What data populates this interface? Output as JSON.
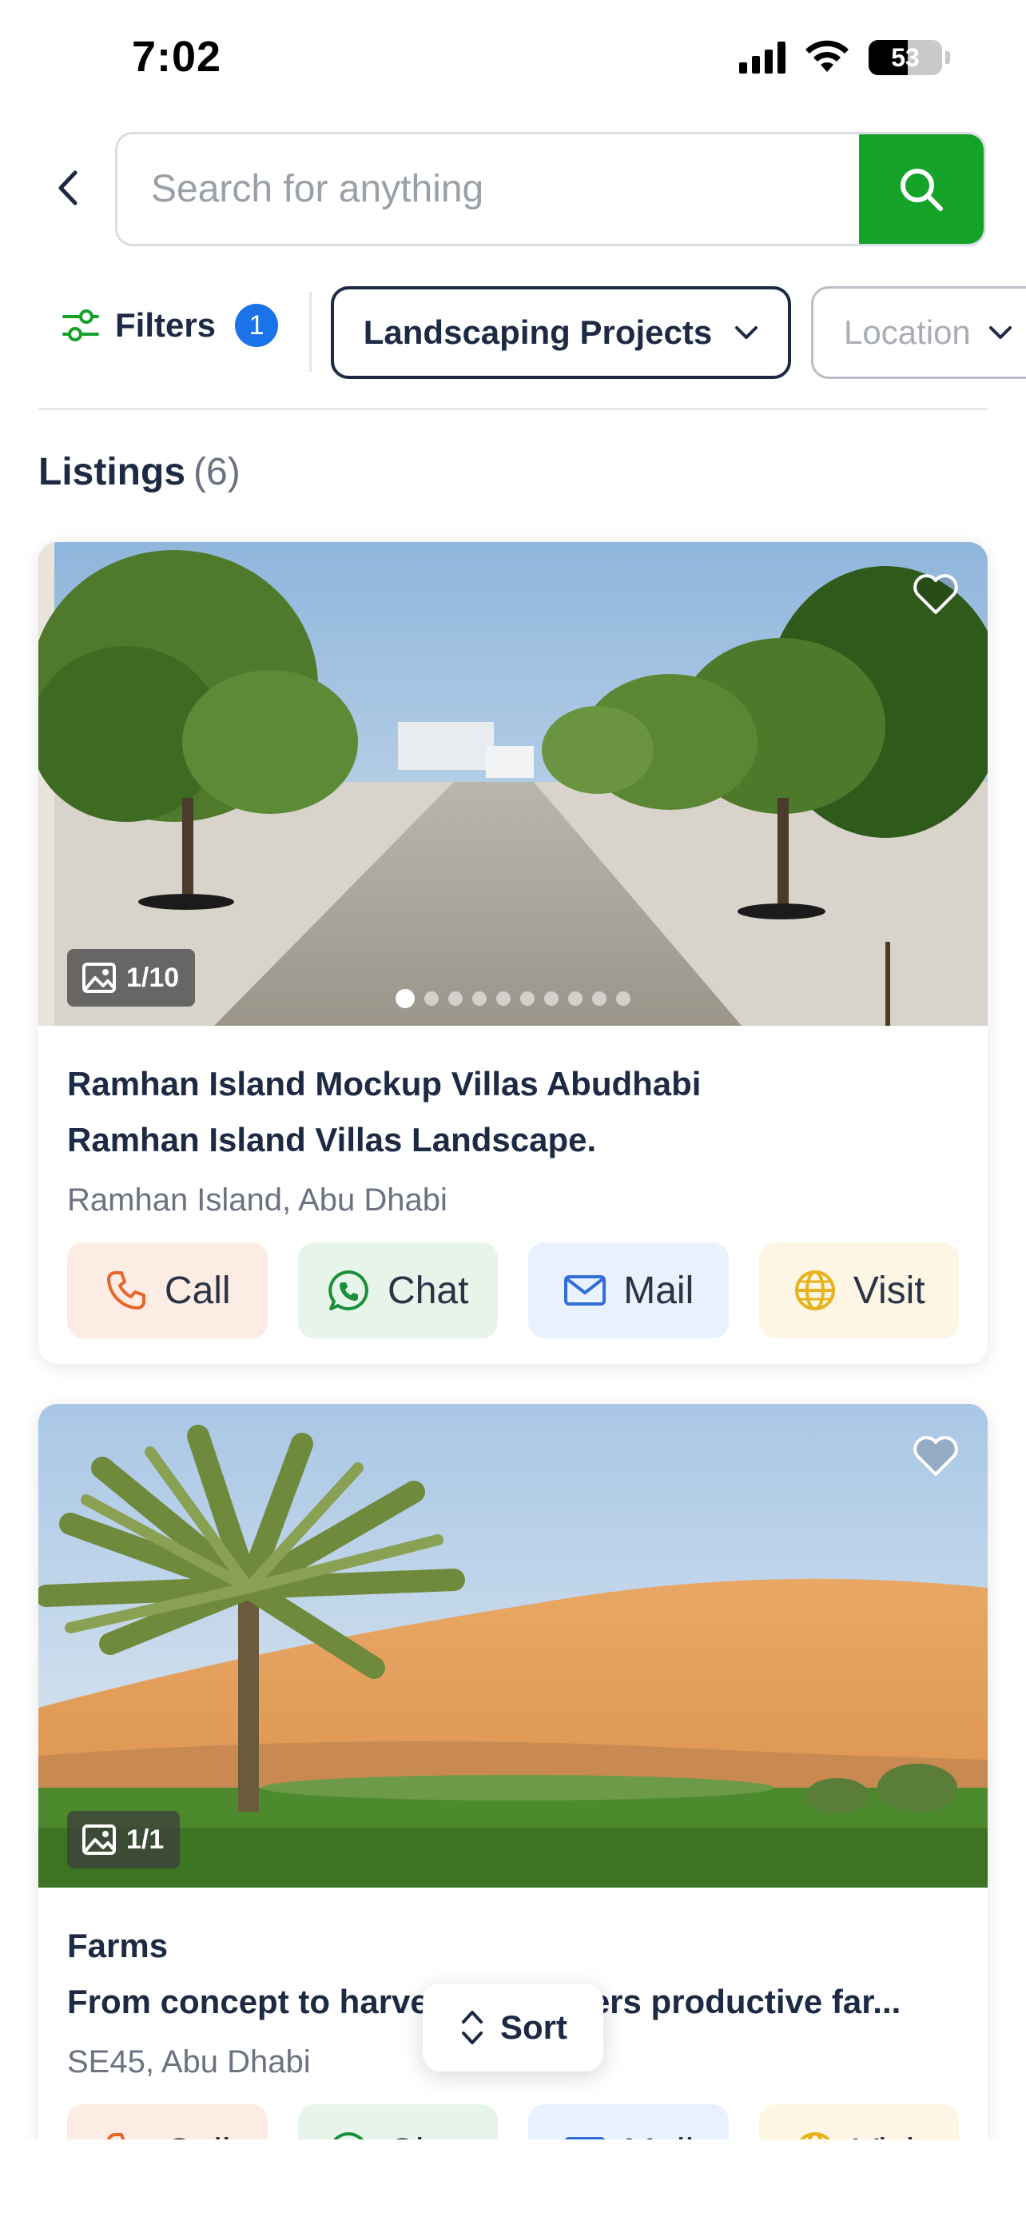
{
  "status_bar": {
    "time": "7:02",
    "battery": "53",
    "battery_level": 0.53
  },
  "search": {
    "placeholder": "Search for anything",
    "value": ""
  },
  "filters": {
    "label": "Filters",
    "badge_count": "1",
    "category_chip": "Landscaping Projects",
    "location_chip": "Location"
  },
  "listings": {
    "heading": "Listings",
    "count": "(6)",
    "items": [
      {
        "image_counter": "1/10",
        "title": "Ramhan Island Mockup Villas Abudhabi",
        "description": "Ramhan Island Villas Landscape.",
        "location": "Ramhan Island, Abu Dhabi",
        "actions": {
          "call": "Call",
          "chat": "Chat",
          "mail": "Mail",
          "visit": "Visit"
        }
      },
      {
        "image_counter": "1/1",
        "title": "Farms",
        "description": "From concept to harvest, ... delivers productive far...",
        "location": "SE45, Abu Dhabi",
        "actions": {
          "call": "Call",
          "chat": "Chat",
          "mail": "Mail",
          "visit": "Visit"
        }
      }
    ]
  },
  "sort": {
    "label": "Sort"
  },
  "colors": {
    "brand_green": "#15a229",
    "badge_blue": "#1a73e8",
    "text_dark": "#1d2a44",
    "text_muted": "#6b7280"
  }
}
